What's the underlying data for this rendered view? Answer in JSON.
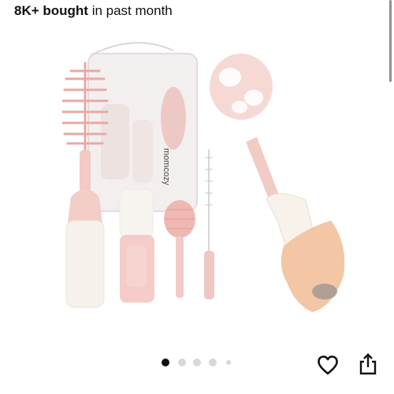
{
  "sales": {
    "count": "8K+ bought",
    "suffix": " in past month"
  },
  "product_image": {
    "brand_print": "momcozy",
    "subject": "bottle-brush-set"
  },
  "carousel": {
    "total_dots": 5,
    "active_index": 0
  },
  "actions": {
    "wishlist_icon": "heart-outline-icon",
    "share_icon": "share-icon"
  },
  "colors": {
    "text": "#0f1111",
    "accent_pink": "#f1c6c2",
    "dot_active": "#111111",
    "dot_inactive": "#d5d9d9"
  }
}
